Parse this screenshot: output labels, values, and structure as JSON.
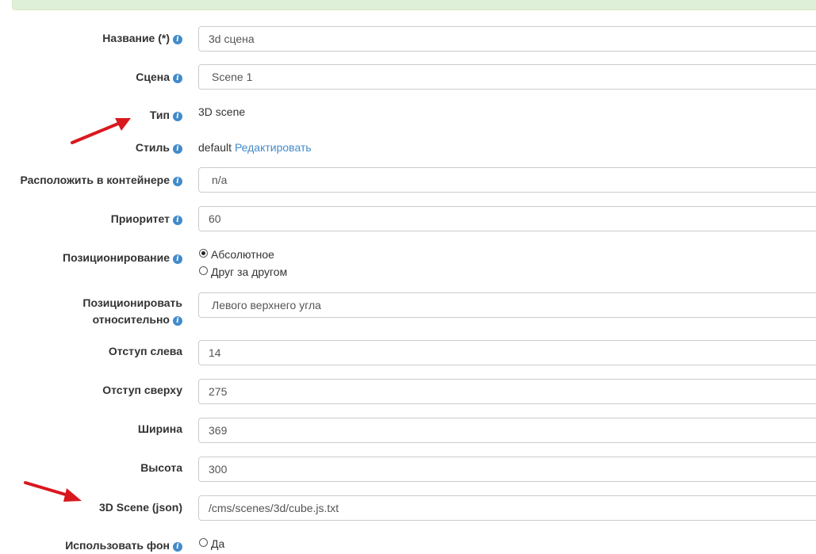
{
  "form": {
    "name": {
      "label": "Название (*)",
      "value": "3d сцена"
    },
    "scene": {
      "label": "Сцена",
      "value": "Scene 1"
    },
    "type": {
      "label": "Тип",
      "value": "3D scene"
    },
    "style": {
      "label": "Стиль",
      "value": "default",
      "edit_link": "Редактировать"
    },
    "container": {
      "label": "Расположить в контейнере",
      "value": "n/a"
    },
    "priority": {
      "label": "Приоритет",
      "value": "60"
    },
    "positioning": {
      "label": "Позиционирование",
      "options": [
        {
          "label": "Абсолютное",
          "checked": true
        },
        {
          "label": "Друг за другом",
          "checked": false
        }
      ]
    },
    "relative_to": {
      "label_line1": "Позиционировать",
      "label_line2": "относительно",
      "value": "Левого верхнего угла"
    },
    "left_offset": {
      "label": "Отступ слева",
      "value": "14"
    },
    "top_offset": {
      "label": "Отступ сверху",
      "value": "275"
    },
    "width": {
      "label": "Ширина",
      "value": "369"
    },
    "height": {
      "label": "Высота",
      "value": "300"
    },
    "scene_json": {
      "label": "3D Scene (json)",
      "value": "/cms/scenes/3d/cube.js.txt"
    },
    "use_background": {
      "label": "Использовать фон",
      "option": "Да"
    }
  },
  "icons": {
    "info": "info-icon",
    "arrow": "red-arrow-annotation"
  },
  "colors": {
    "link": "#428bca",
    "arrow": "#d9181e",
    "alert_bg": "#dff0d8"
  }
}
